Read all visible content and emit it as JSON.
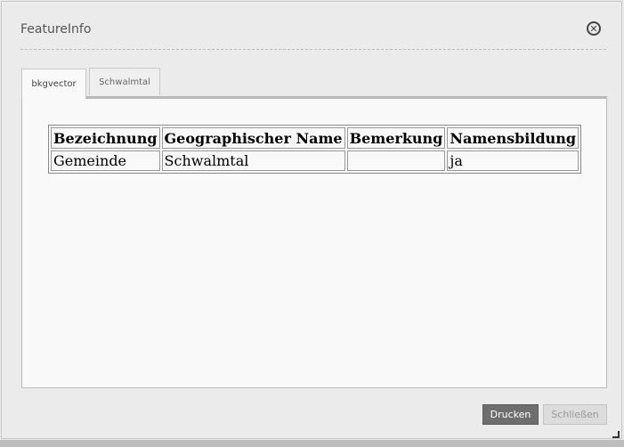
{
  "dialog": {
    "title": "FeatureInfo",
    "close_icon": "close-circle-icon"
  },
  "tabs": [
    {
      "label": "bkgvector",
      "active": true
    },
    {
      "label": "Schwalmtal",
      "active": false
    }
  ],
  "table": {
    "headers": [
      "Bezeichnung",
      "Geographischer Name",
      "Bemerkung",
      "Namensbildung"
    ],
    "rows": [
      [
        "Gemeinde",
        "Schwalmtal",
        "",
        "ja"
      ]
    ]
  },
  "buttons": {
    "print": "Drucken",
    "close": "Schließen"
  },
  "icons": {
    "resize": "resize-handle-icon"
  },
  "colors": {
    "print_button": "#6e6e6e",
    "panel_bg": "#f9f9f9"
  }
}
